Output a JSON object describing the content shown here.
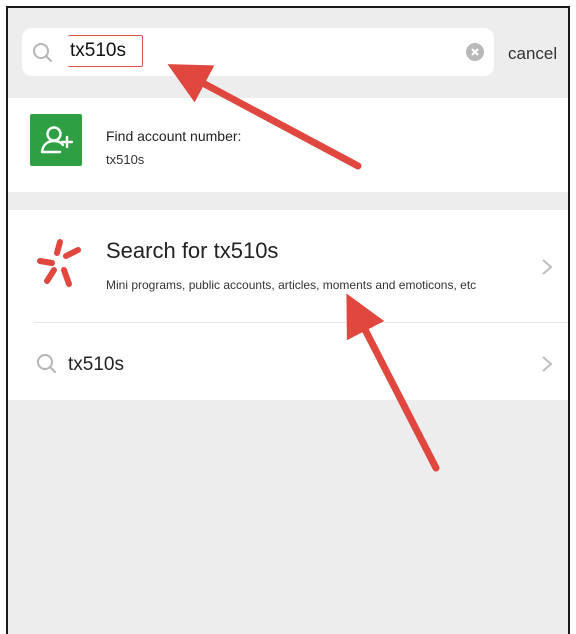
{
  "search": {
    "query": "tx510s",
    "cancel_label": "cancel"
  },
  "account_card": {
    "label": "Find account number:",
    "value": "tx510s"
  },
  "search_for": {
    "title": "Search for tx510s",
    "subtitle": "Mini programs, public accounts, articles, moments and emoticons, etc"
  },
  "suggestion": {
    "text": "tx510s"
  },
  "colors": {
    "accent_green": "#2ea043",
    "annotation_red": "#e0473f",
    "background": "#ededed"
  },
  "icons": [
    "search-icon",
    "clear-icon",
    "add-contact-icon",
    "search-brand-icon",
    "chevron-right-icon"
  ]
}
